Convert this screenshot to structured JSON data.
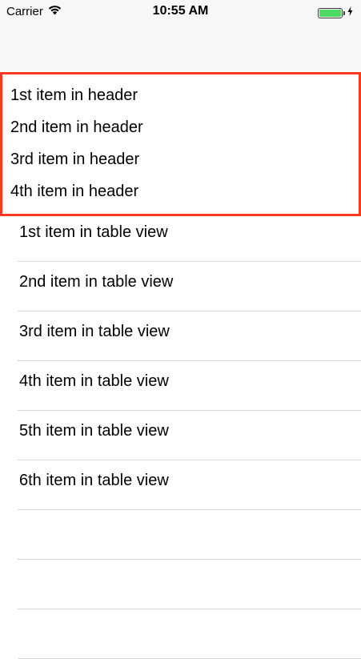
{
  "status_bar": {
    "carrier": "Carrier",
    "time": "10:55 AM",
    "battery_color": "#4cd964"
  },
  "header": {
    "border_color": "#fc3a1d",
    "items": [
      {
        "label": "1st item in header"
      },
      {
        "label": "2nd item in header"
      },
      {
        "label": "3rd item in header"
      },
      {
        "label": "4th item in header"
      }
    ]
  },
  "table": {
    "rows": [
      {
        "label": "1st item in table view"
      },
      {
        "label": "2nd item in table view"
      },
      {
        "label": "3rd item in table view"
      },
      {
        "label": "4th item in table view"
      },
      {
        "label": "5th item in table view"
      },
      {
        "label": "6th item in table view"
      },
      {
        "label": ""
      },
      {
        "label": ""
      },
      {
        "label": ""
      }
    ]
  }
}
